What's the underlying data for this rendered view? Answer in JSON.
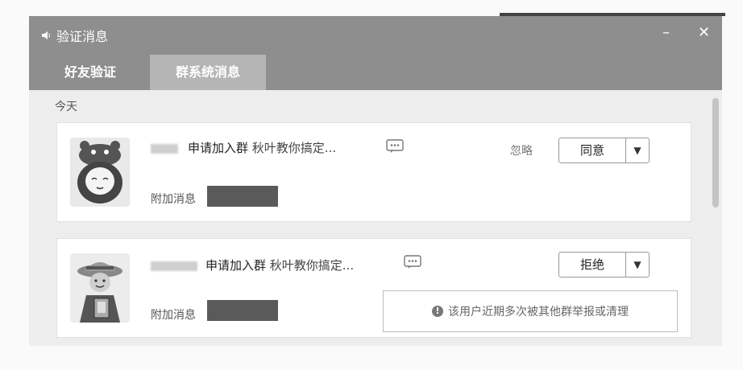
{
  "window": {
    "title": "验证消息",
    "minimize": "–",
    "close": "✕"
  },
  "tabs": [
    {
      "label": "好友验证"
    },
    {
      "label": "群系统消息"
    }
  ],
  "section": {
    "date": "今天"
  },
  "requests": [
    {
      "action": "申请加入群",
      "group": "秋叶教你搞定...",
      "extra_label": "附加消息",
      "ignore_label": "忽略",
      "button_label": "同意",
      "dropdown": "▼",
      "avatar_icon": "crab-hat-avatar-icon"
    },
    {
      "action": "申请加入群",
      "group": "秋叶教你搞定...",
      "extra_label": "附加消息",
      "button_label": "拒绝",
      "dropdown": "▼",
      "warning": "该用户近期多次被其他群举报或清理",
      "warning_icon": "!",
      "avatar_icon": "straw-hat-avatar-icon"
    }
  ]
}
